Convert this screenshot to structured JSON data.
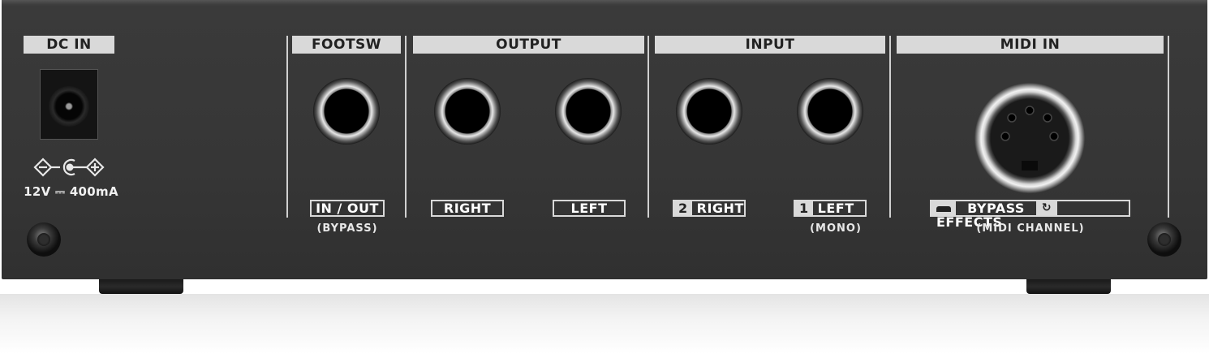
{
  "sections": {
    "dc_in": "DC IN",
    "footsw": "FOOTSW",
    "output": "OUTPUT",
    "input": "INPUT",
    "midi_in": "MIDI IN"
  },
  "power": {
    "spec": "12V ⎓ 400mA"
  },
  "labels": {
    "in_out": "IN / OUT",
    "bypass_sub": "(BYPASS)",
    "out_right": "RIGHT",
    "out_left": "LEFT",
    "in_right_num": "2",
    "in_right": "RIGHT",
    "in_left_num": "1",
    "in_left": "LEFT",
    "mono_sub": "(MONO)",
    "midi_bypass": "BYPASS",
    "midi_effects": "EFFECTS",
    "midi_channel_sub": "(MIDI CHANNEL)"
  },
  "colors": {
    "panel": "#363636",
    "label_bar": "#d9d9d9",
    "text_light": "#ffffff"
  }
}
